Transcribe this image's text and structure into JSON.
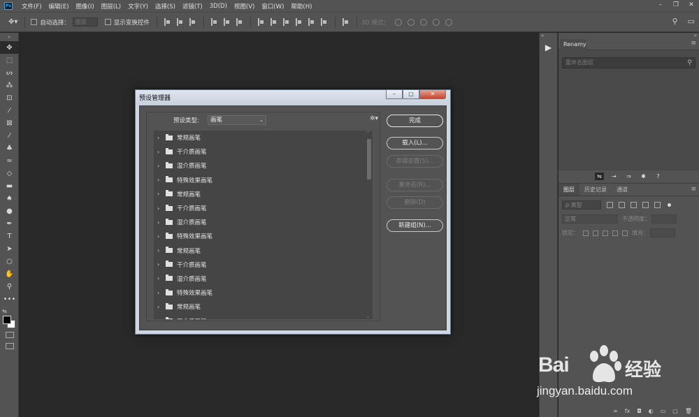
{
  "app": {
    "logo": "Ps",
    "menu": [
      "文件(F)",
      "编辑(E)",
      "图像(I)",
      "图层(L)",
      "文字(Y)",
      "选择(S)",
      "滤镜(T)",
      "3D(D)",
      "视图(V)",
      "窗口(W)",
      "帮助(H)"
    ],
    "window_controls": [
      "–",
      "❐",
      "✕"
    ]
  },
  "options_bar": {
    "auto_select_label": "自动选择：",
    "auto_select_value": "图层",
    "show_transform_label": "显示变换控件",
    "mode_3d_label": "3D 模式："
  },
  "colors": {
    "foreground": "#000000",
    "background": "#ffffff",
    "ps_blue": "#31a8ff"
  },
  "tools": [
    "move-tool-icon",
    "marquee-tool-icon",
    "lasso-tool-icon",
    "magic-wand-icon",
    "crop-tool-icon",
    "eyedropper-icon",
    "frame-tool-icon",
    "brush-icon",
    "clone-stamp-icon",
    "history-brush-icon",
    "eraser-icon",
    "gradient-icon",
    "blur-icon",
    "dodge-icon",
    "pen-icon",
    "type-icon",
    "path-select-icon",
    "ellipse-icon",
    "hand-icon",
    "zoom-icon",
    "more-tools-icon"
  ],
  "tool_glyphs": [
    "✥",
    "⬚",
    "ᔕ",
    "⁂",
    "⊡",
    "⁄",
    "⊠",
    "⁄",
    "♣",
    "≈",
    "◇",
    "▬",
    "♠",
    "●",
    "✒",
    "T",
    "➤",
    "○",
    "✋",
    "⚲",
    "•••"
  ],
  "renamy": {
    "tab": "Renamy",
    "search_placeholder": "重命名图层",
    "footer_glyphs": [
      "⇋",
      "→",
      "⇒",
      "✱",
      "?"
    ]
  },
  "layers_panel": {
    "tabs": [
      "图层",
      "历史记录",
      "通道"
    ],
    "filter_value": "ρ 类型",
    "blend_value": "正常",
    "opacity_label": "不透明度：",
    "lock_label": "锁定：",
    "fill_label": "填充：",
    "bottom_glyphs": [
      "∞",
      "fx",
      "◘",
      "◐",
      "▭",
      "▢",
      "🗑"
    ]
  },
  "dialog": {
    "title": "预设管理器",
    "window_buttons": [
      "–",
      "□",
      "✕"
    ],
    "preset_type_label": "预设类型:",
    "preset_type_value": "画笔",
    "items": [
      "常规画笔",
      "干介质画笔",
      "湿介质画笔",
      "特殊效果画笔",
      "常规画笔",
      "干介质画笔",
      "湿介质画笔",
      "特殊效果画笔",
      "常规画笔",
      "干介质画笔",
      "湿介质画笔",
      "特殊效果画笔",
      "常规画笔",
      "干介质画笔"
    ],
    "buttons": {
      "done": "完成",
      "load": "载入(L)...",
      "save": "存储设置(S)...",
      "rename": "重命名(R)...",
      "delete": "删除(D)",
      "new_group": "新建组(N)..."
    }
  },
  "watermark": {
    "brand": "Bai",
    "brand_cn": "经验",
    "url": "jingyan.baidu.com"
  }
}
